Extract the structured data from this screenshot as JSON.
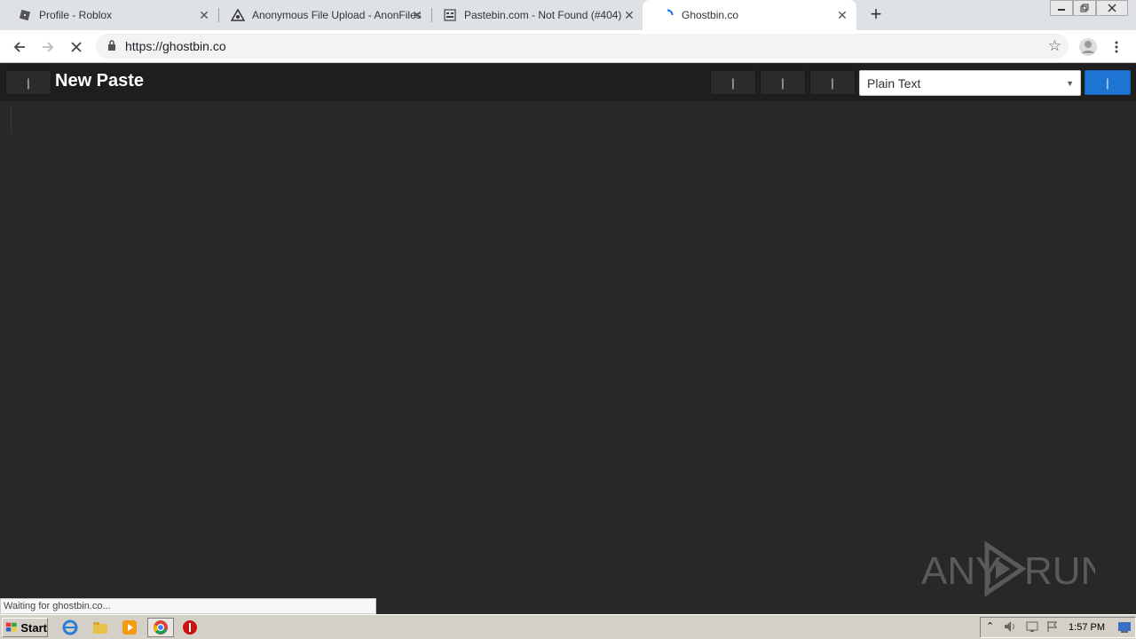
{
  "browser": {
    "tabs": [
      {
        "title": "Profile - Roblox",
        "icon": "roblox-icon"
      },
      {
        "title": "Anonymous File Upload - AnonFiles",
        "icon": "anonfiles-icon"
      },
      {
        "title": "Pastebin.com - Not Found (#404)",
        "icon": "pastebin-icon"
      },
      {
        "title": "Ghostbin.co",
        "icon": "loading-spinner-icon",
        "active": true
      }
    ],
    "close_glyph": "✕",
    "new_tab_glyph": "+",
    "url": "https://ghostbin.co"
  },
  "page": {
    "title": "New Paste",
    "menu_button_label": "|",
    "tool_button_labels": [
      "|",
      "|",
      "|"
    ],
    "language_selected": "Plain Text",
    "save_button_label": "|"
  },
  "status_text": "Waiting for ghostbin.co...",
  "watermark_text": "ANY RUN",
  "taskbar": {
    "start_label": "Start",
    "clock": "1:57 PM"
  },
  "colors": {
    "page_bg": "#282828",
    "header_bg": "#1e1e1e",
    "accent": "#1e74d3"
  }
}
